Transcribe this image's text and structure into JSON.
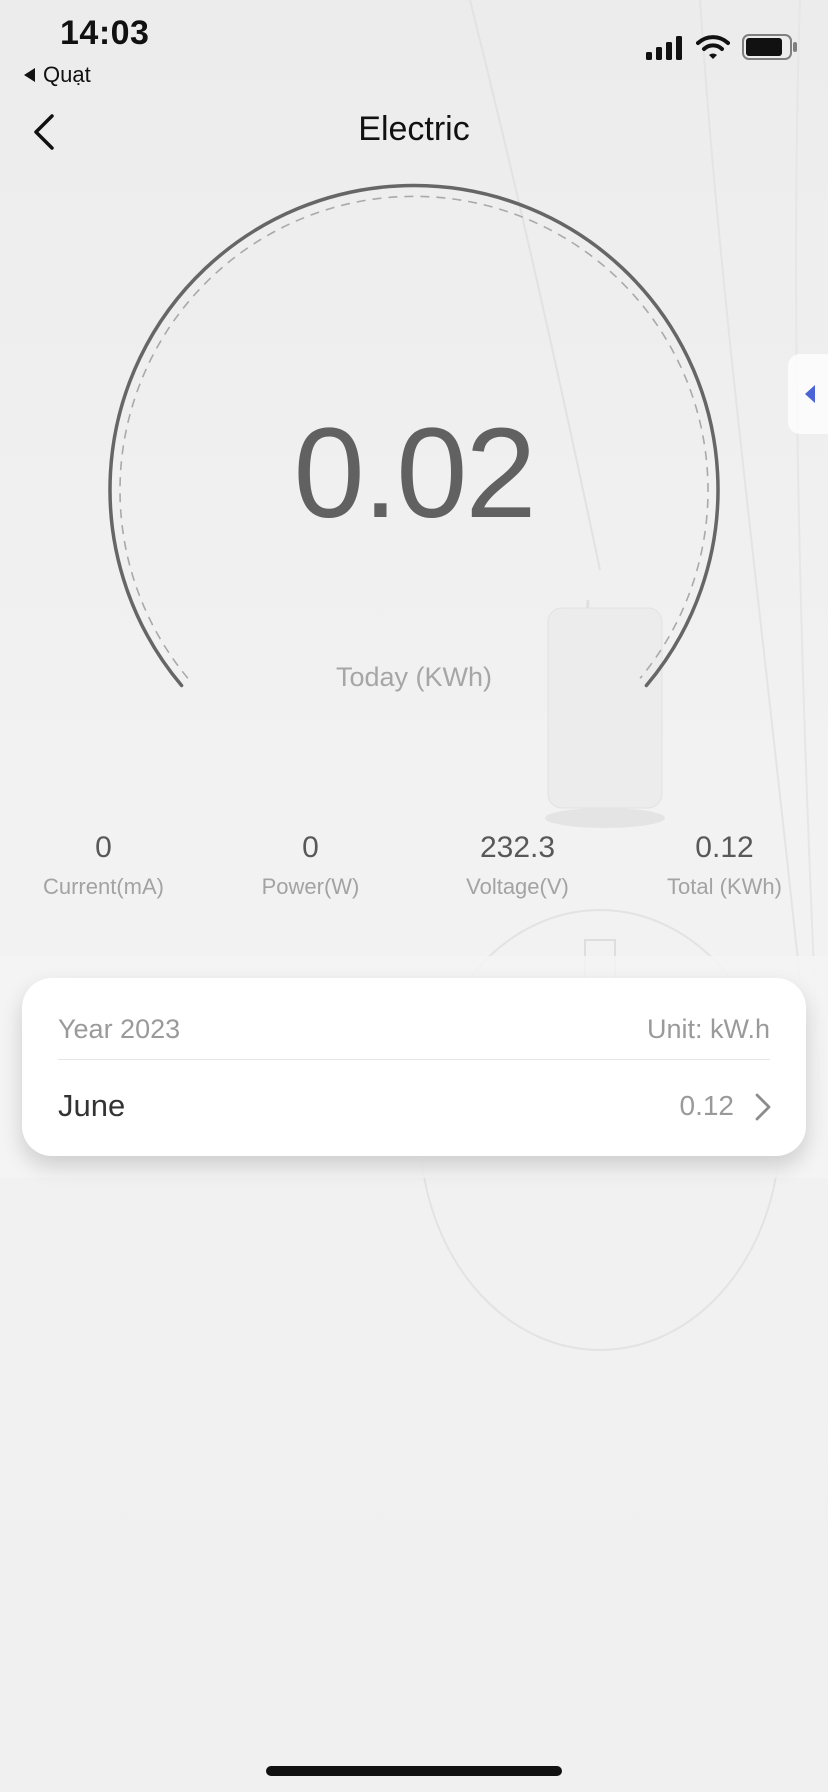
{
  "status_bar": {
    "time": "14:03",
    "back_app": "Quạt"
  },
  "nav": {
    "title": "Electric"
  },
  "gauge": {
    "value": "0.02",
    "label": "Today (KWh)"
  },
  "metrics": [
    {
      "value": "0",
      "label": "Current(mA)"
    },
    {
      "value": "0",
      "label": "Power(W)"
    },
    {
      "value": "232.3",
      "label": "Voltage(V)"
    },
    {
      "value": "0.12",
      "label": "Total (KWh)"
    }
  ],
  "card": {
    "year": "Year 2023",
    "unit": "Unit: kW.h",
    "rows": [
      {
        "month": "June",
        "value": "0.12"
      }
    ]
  },
  "colors": {
    "accent": "#4a63d6",
    "gauge_stroke": "#666666",
    "value_text": "#616161"
  }
}
